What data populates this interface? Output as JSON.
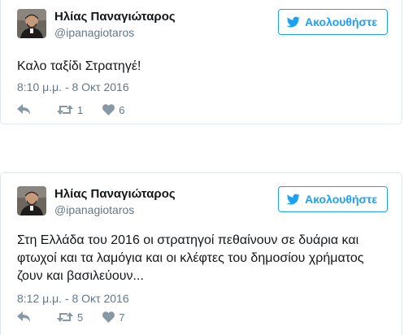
{
  "tweets": [
    {
      "user": {
        "name": "Ηλίας Παναγιώταρος",
        "handle": "@ipanagiotaros"
      },
      "follow_label": "Ακολουθήστε",
      "text": "Καλο ταξίδι Στρατηγέ!",
      "timestamp": "8:10 μ.μ. - 8 Οκτ 2016",
      "retweets": "1",
      "likes": "6"
    },
    {
      "user": {
        "name": "Ηλίας Παναγιώταρος",
        "handle": "@ipanagiotaros"
      },
      "follow_label": "Ακολουθήστε",
      "text": "Στη Ελλάδα του 2016 οι στρατηγοί πεθαίνουν σε δυάρια και φτωχοί και τα λαμόγια και οι κλέφτες του δημοσίου χρήματος ζουν και βασιλεύουν...",
      "timestamp": "8:12 μ.μ. - 8 Οκτ 2016",
      "retweets": "5",
      "likes": "7"
    }
  ],
  "icons": {
    "reply": "reply-icon",
    "retweet": "retweet-icon",
    "like": "heart-icon",
    "follow": "twitter-bird-icon"
  },
  "colors": {
    "accent": "#1da1f2",
    "text": "#14171a",
    "muted": "#657786",
    "icon": "#8899a6",
    "border": "#e1e8ed"
  }
}
